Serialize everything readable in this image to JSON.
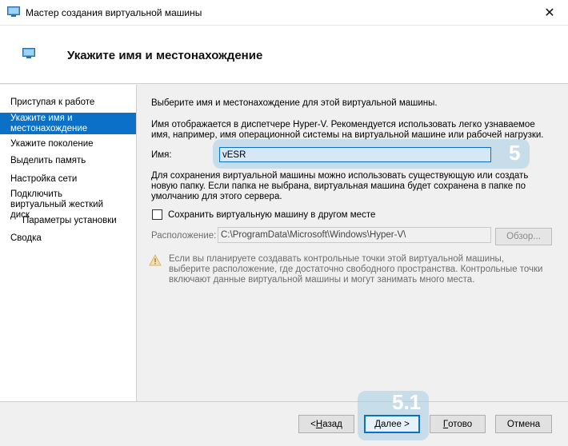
{
  "window": {
    "title": "Мастер создания виртуальной машины",
    "close_glyph": "✕"
  },
  "header": {
    "title": "Укажите имя и местонахождение"
  },
  "nav": {
    "items": [
      {
        "label": "Приступая к работе"
      },
      {
        "label": "Укажите имя и местонахождение",
        "active": true
      },
      {
        "label": "Укажите поколение"
      },
      {
        "label": "Выделить память"
      },
      {
        "label": "Настройка сети"
      },
      {
        "label": "Подключить виртуальный жесткий диск"
      },
      {
        "label": "Параметры установки",
        "sub": true
      },
      {
        "label": "Сводка"
      }
    ]
  },
  "content": {
    "intro": "Выберите имя и местонахождение для этой виртуальной машины.",
    "description": "Имя отображается в диспетчере Hyper-V. Рекомендуется использовать легко узнаваемое имя, например, имя операционной системы на виртуальной машине или рабочей нагрузки.",
    "name_label": "Имя:",
    "name_value": "vESR",
    "storage_text": "Для сохранения виртуальной машины можно использовать существующую или создать новую папку. Если папка не выбрана, виртуальная машина будет сохранена в папке по умолчанию для этого сервера.",
    "checkbox_label": "Сохранить виртуальную машину в другом месте",
    "checkbox_checked": false,
    "location_label": "Расположение:",
    "location_value": "C:\\ProgramData\\Microsoft\\Windows\\Hyper-V\\",
    "browse_label": "Обзор...",
    "warning": "Если вы планируете создавать контрольные точки этой виртуальной машины, выберите расположение, где достаточно свободного пространства. Контрольные точки включают данные виртуальной машины и могут занимать много места."
  },
  "annotations": {
    "step_name": "5",
    "step_next": "5.1",
    "highlight_color": "#a5cde6"
  },
  "footer": {
    "back": {
      "pre": "< ",
      "hotkey": "Н",
      "post": "азад"
    },
    "next": {
      "pre": "",
      "hotkey": "Д",
      "post": "алее >"
    },
    "finish": {
      "pre": "",
      "hotkey": "Г",
      "post": "отово"
    },
    "cancel_label": "Отмена"
  },
  "colors": {
    "accent": "#0b71c8",
    "selected_input_bg": "#d6e8f8",
    "window_bg": "#f0f0f0"
  }
}
